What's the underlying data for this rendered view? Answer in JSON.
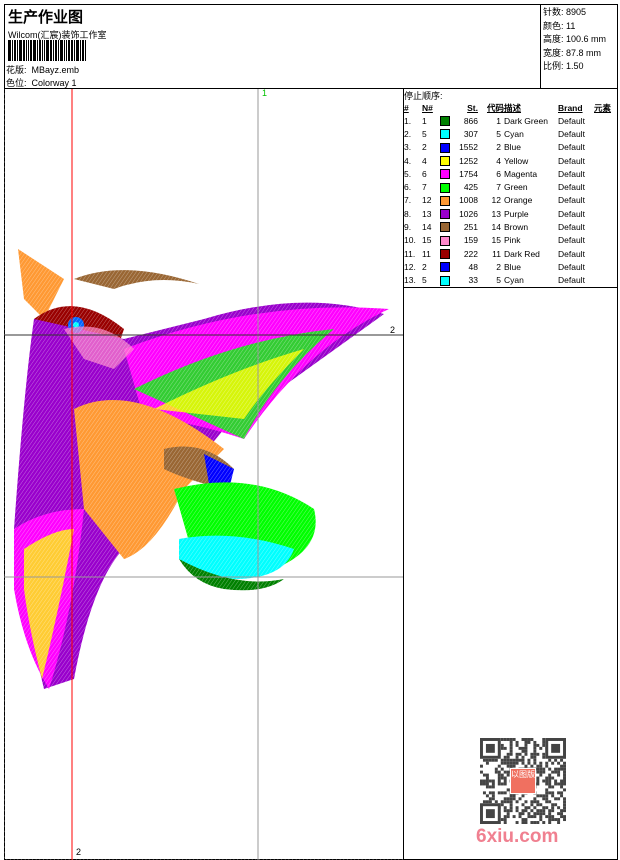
{
  "header": {
    "title": "生产作业图",
    "company": "Wilcom(汇宸)装饰工作室",
    "design_label": "花版:",
    "design_value": "MBayz.emb",
    "colorway_label": "色位:",
    "colorway_value": "Colorway 1"
  },
  "info": {
    "stitches": "针数: 8905",
    "colors": "颜色: 11",
    "height": "高度: 100.6 mm",
    "width": "宽度: 87.8 mm",
    "scale": "比例: 1.50"
  },
  "guides": {
    "v1": "1",
    "h2": "2",
    "v2": "2"
  },
  "stop_sequence": {
    "title": "停止顺序:",
    "headers": [
      "#",
      "N#",
      "",
      "St.",
      "代码",
      "描述",
      "Brand",
      "元素"
    ],
    "rows": [
      {
        "idx": "1.",
        "n": "1",
        "color": "#008000",
        "st": "866",
        "code": "1",
        "desc": "Dark Green",
        "brand": "Default"
      },
      {
        "idx": "2.",
        "n": "5",
        "color": "#00ffff",
        "st": "307",
        "code": "5",
        "desc": "Cyan",
        "brand": "Default"
      },
      {
        "idx": "3.",
        "n": "2",
        "color": "#0000ff",
        "st": "1552",
        "code": "2",
        "desc": "Blue",
        "brand": "Default"
      },
      {
        "idx": "4.",
        "n": "4",
        "color": "#ffff00",
        "st": "1252",
        "code": "4",
        "desc": "Yellow",
        "brand": "Default"
      },
      {
        "idx": "5.",
        "n": "6",
        "color": "#ff00ff",
        "st": "1754",
        "code": "6",
        "desc": "Magenta",
        "brand": "Default"
      },
      {
        "idx": "6.",
        "n": "7",
        "color": "#00ff00",
        "st": "425",
        "code": "7",
        "desc": "Green",
        "brand": "Default"
      },
      {
        "idx": "7.",
        "n": "12",
        "color": "#ff9933",
        "st": "1008",
        "code": "12",
        "desc": "Orange",
        "brand": "Default"
      },
      {
        "idx": "8.",
        "n": "13",
        "color": "#9900cc",
        "st": "1026",
        "code": "13",
        "desc": "Purple",
        "brand": "Default"
      },
      {
        "idx": "9.",
        "n": "14",
        "color": "#996633",
        "st": "251",
        "code": "14",
        "desc": "Brown",
        "brand": "Default"
      },
      {
        "idx": "10.",
        "n": "15",
        "color": "#ff88cc",
        "st": "159",
        "code": "15",
        "desc": "Pink",
        "brand": "Default"
      },
      {
        "idx": "11.",
        "n": "11",
        "color": "#990000",
        "st": "222",
        "code": "11",
        "desc": "Dark Red",
        "brand": "Default"
      },
      {
        "idx": "12.",
        "n": "2",
        "color": "#0000ff",
        "st": "48",
        "code": "2",
        "desc": "Blue",
        "brand": "Default"
      },
      {
        "idx": "13.",
        "n": "5",
        "color": "#00ffff",
        "st": "33",
        "code": "5",
        "desc": "Cyan",
        "brand": "Default"
      }
    ]
  },
  "watermark": {
    "text": "6xiu.com",
    "seal": "以图版"
  }
}
